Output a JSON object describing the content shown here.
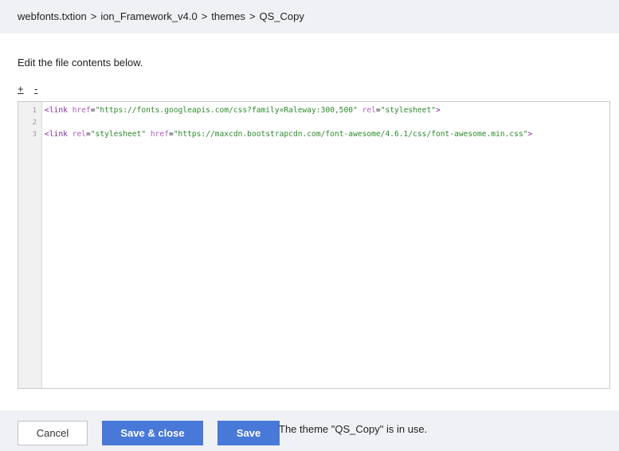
{
  "breadcrumb": {
    "items": [
      "webfonts.txtion",
      "ion_Framework_v4.0",
      "themes",
      "QS_Copy"
    ],
    "separator": ">"
  },
  "instructions": "Edit the file contents below.",
  "zoom": {
    "increase_label": "+",
    "decrease_label": "-"
  },
  "editor": {
    "line_numbers": [
      "1",
      "2",
      "3"
    ],
    "lines": [
      {
        "tag_open": "<link",
        "attr1": "href",
        "val1": "\"https://fonts.googleapis.com/css?family=Raleway:300,500\"",
        "attr2": "rel",
        "val2": "\"stylesheet\"",
        "tag_close": ">"
      },
      {
        "tag_open": "<link",
        "attr1": "rel",
        "val1": "\"stylesheet\"",
        "attr2": "href",
        "val2": "\"https://maxcdn.bootstrapcdn.com/font-awesome/4.6.1/css/font-awesome.min.css\"",
        "tag_close": ">"
      }
    ]
  },
  "footer": {
    "cancel_label": "Cancel",
    "save_close_label": "Save & close",
    "save_label": "Save",
    "status_text": "The theme \"QS_Copy\" is in use."
  },
  "colors": {
    "accent": "#4878d8",
    "tag": "#7c2d9c",
    "attribute": "#b05fc0",
    "string": "#2d8a2d"
  }
}
